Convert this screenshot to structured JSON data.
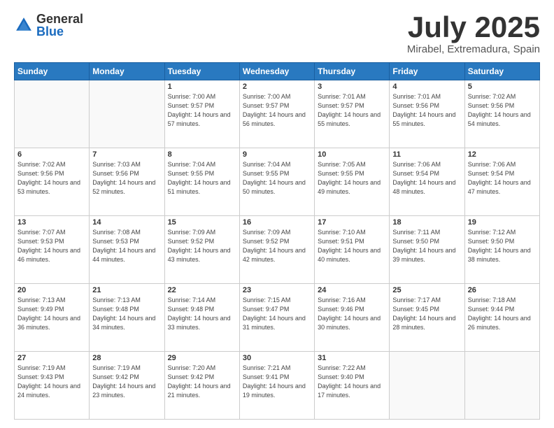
{
  "header": {
    "logo_general": "General",
    "logo_blue": "Blue",
    "title": "July 2025",
    "location": "Mirabel, Extremadura, Spain"
  },
  "weekdays": [
    "Sunday",
    "Monday",
    "Tuesday",
    "Wednesday",
    "Thursday",
    "Friday",
    "Saturday"
  ],
  "weeks": [
    [
      {
        "day": null
      },
      {
        "day": null
      },
      {
        "day": "1",
        "sunrise": "7:00 AM",
        "sunset": "9:57 PM",
        "daylight": "14 hours and 57 minutes."
      },
      {
        "day": "2",
        "sunrise": "7:00 AM",
        "sunset": "9:57 PM",
        "daylight": "14 hours and 56 minutes."
      },
      {
        "day": "3",
        "sunrise": "7:01 AM",
        "sunset": "9:57 PM",
        "daylight": "14 hours and 55 minutes."
      },
      {
        "day": "4",
        "sunrise": "7:01 AM",
        "sunset": "9:56 PM",
        "daylight": "14 hours and 55 minutes."
      },
      {
        "day": "5",
        "sunrise": "7:02 AM",
        "sunset": "9:56 PM",
        "daylight": "14 hours and 54 minutes."
      }
    ],
    [
      {
        "day": "6",
        "sunrise": "7:02 AM",
        "sunset": "9:56 PM",
        "daylight": "14 hours and 53 minutes."
      },
      {
        "day": "7",
        "sunrise": "7:03 AM",
        "sunset": "9:56 PM",
        "daylight": "14 hours and 52 minutes."
      },
      {
        "day": "8",
        "sunrise": "7:04 AM",
        "sunset": "9:55 PM",
        "daylight": "14 hours and 51 minutes."
      },
      {
        "day": "9",
        "sunrise": "7:04 AM",
        "sunset": "9:55 PM",
        "daylight": "14 hours and 50 minutes."
      },
      {
        "day": "10",
        "sunrise": "7:05 AM",
        "sunset": "9:55 PM",
        "daylight": "14 hours and 49 minutes."
      },
      {
        "day": "11",
        "sunrise": "7:06 AM",
        "sunset": "9:54 PM",
        "daylight": "14 hours and 48 minutes."
      },
      {
        "day": "12",
        "sunrise": "7:06 AM",
        "sunset": "9:54 PM",
        "daylight": "14 hours and 47 minutes."
      }
    ],
    [
      {
        "day": "13",
        "sunrise": "7:07 AM",
        "sunset": "9:53 PM",
        "daylight": "14 hours and 46 minutes."
      },
      {
        "day": "14",
        "sunrise": "7:08 AM",
        "sunset": "9:53 PM",
        "daylight": "14 hours and 44 minutes."
      },
      {
        "day": "15",
        "sunrise": "7:09 AM",
        "sunset": "9:52 PM",
        "daylight": "14 hours and 43 minutes."
      },
      {
        "day": "16",
        "sunrise": "7:09 AM",
        "sunset": "9:52 PM",
        "daylight": "14 hours and 42 minutes."
      },
      {
        "day": "17",
        "sunrise": "7:10 AM",
        "sunset": "9:51 PM",
        "daylight": "14 hours and 40 minutes."
      },
      {
        "day": "18",
        "sunrise": "7:11 AM",
        "sunset": "9:50 PM",
        "daylight": "14 hours and 39 minutes."
      },
      {
        "day": "19",
        "sunrise": "7:12 AM",
        "sunset": "9:50 PM",
        "daylight": "14 hours and 38 minutes."
      }
    ],
    [
      {
        "day": "20",
        "sunrise": "7:13 AM",
        "sunset": "9:49 PM",
        "daylight": "14 hours and 36 minutes."
      },
      {
        "day": "21",
        "sunrise": "7:13 AM",
        "sunset": "9:48 PM",
        "daylight": "14 hours and 34 minutes."
      },
      {
        "day": "22",
        "sunrise": "7:14 AM",
        "sunset": "9:48 PM",
        "daylight": "14 hours and 33 minutes."
      },
      {
        "day": "23",
        "sunrise": "7:15 AM",
        "sunset": "9:47 PM",
        "daylight": "14 hours and 31 minutes."
      },
      {
        "day": "24",
        "sunrise": "7:16 AM",
        "sunset": "9:46 PM",
        "daylight": "14 hours and 30 minutes."
      },
      {
        "day": "25",
        "sunrise": "7:17 AM",
        "sunset": "9:45 PM",
        "daylight": "14 hours and 28 minutes."
      },
      {
        "day": "26",
        "sunrise": "7:18 AM",
        "sunset": "9:44 PM",
        "daylight": "14 hours and 26 minutes."
      }
    ],
    [
      {
        "day": "27",
        "sunrise": "7:19 AM",
        "sunset": "9:43 PM",
        "daylight": "14 hours and 24 minutes."
      },
      {
        "day": "28",
        "sunrise": "7:19 AM",
        "sunset": "9:42 PM",
        "daylight": "14 hours and 23 minutes."
      },
      {
        "day": "29",
        "sunrise": "7:20 AM",
        "sunset": "9:42 PM",
        "daylight": "14 hours and 21 minutes."
      },
      {
        "day": "30",
        "sunrise": "7:21 AM",
        "sunset": "9:41 PM",
        "daylight": "14 hours and 19 minutes."
      },
      {
        "day": "31",
        "sunrise": "7:22 AM",
        "sunset": "9:40 PM",
        "daylight": "14 hours and 17 minutes."
      },
      {
        "day": null
      },
      {
        "day": null
      }
    ]
  ]
}
